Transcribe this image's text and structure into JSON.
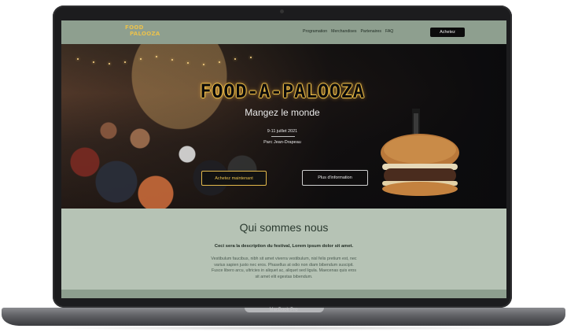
{
  "device": {
    "label": "MacBook Pro"
  },
  "nav": {
    "logo_line1": "FOOD",
    "logo_line2": "PALOOZA",
    "items": [
      "Programation",
      "Merchandises",
      "Partenaires",
      "FAQ"
    ],
    "cta_label": "Achetez"
  },
  "hero": {
    "title": "FOOD-A-PALOOZA",
    "subtitle": "Mangez le monde",
    "dates": "9-11 juillet 2021",
    "place": "Parc Jean-Drapeau",
    "buy_label": "Achetez maintenant",
    "info_label": "Plus d'information"
  },
  "about": {
    "title": "Qui sommes nous",
    "lead": "Ceci sera la description du festival, Lorem ipsum dolor sit amet.",
    "body": "Vestibulum faucibus, nibh sit amet viverra vestibulum, nisl felis pretium est, nec varius sapien justo nec eros. Phasellus at odio non diam bibendum suscipit. Fusce libero arcu, ultricies in aliquet ac, aliquet sed ligula. Maecenas quis eros sit amet elit egestas bibendum."
  },
  "colors": {
    "nav_bg": "#8e9f8f",
    "page_bg": "#b6c3b5",
    "accent_gold": "#e9c14d",
    "hero_dark": "#0b0b0d"
  }
}
